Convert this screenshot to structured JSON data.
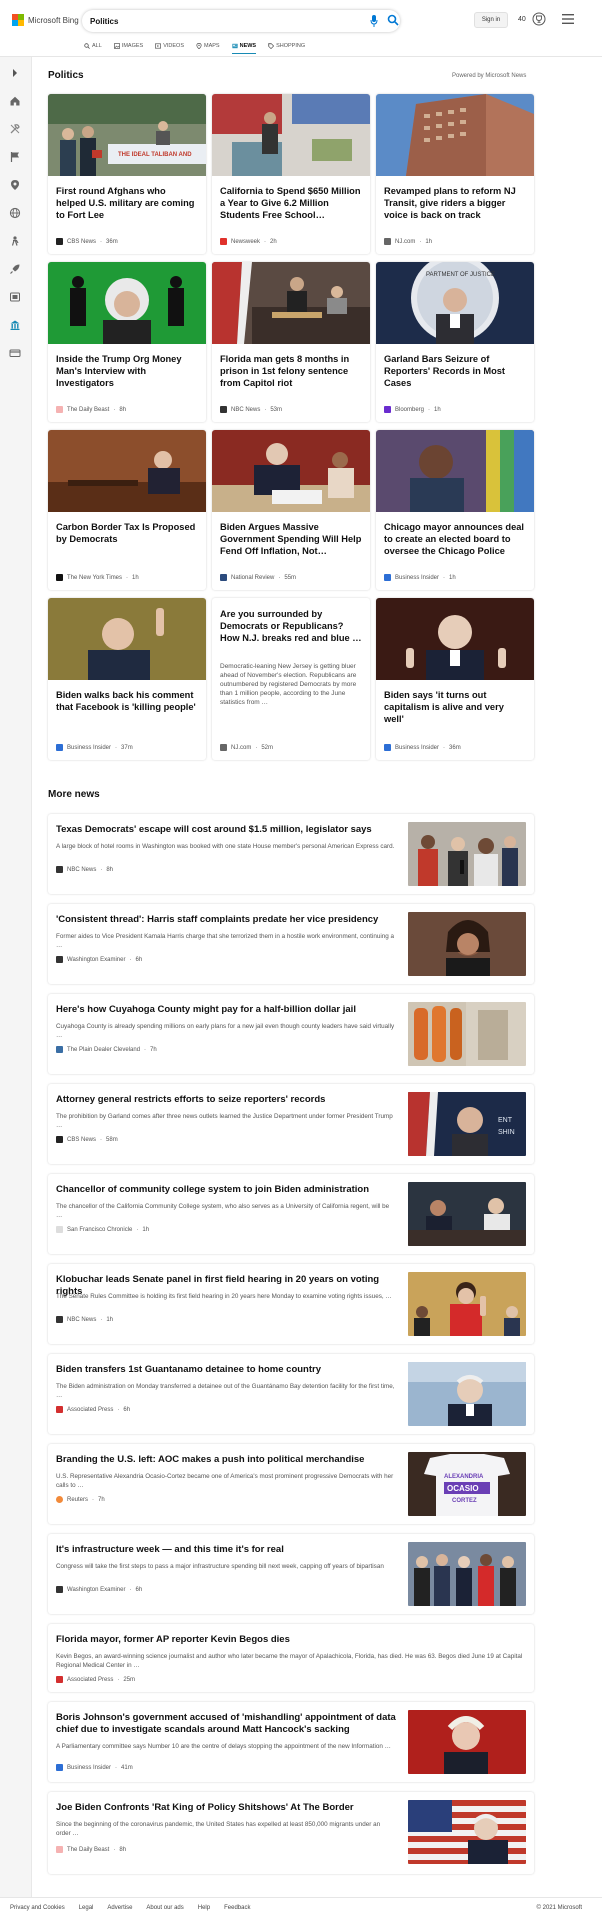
{
  "header": {
    "brand": "Microsoft Bing",
    "search_value": "Politics",
    "signin_label": "Sign in",
    "rewards_count": "40"
  },
  "tabs": [
    {
      "label": "ALL",
      "icon": "search-icon"
    },
    {
      "label": "IMAGES",
      "icon": "image-icon"
    },
    {
      "label": "VIDEOS",
      "icon": "video-icon"
    },
    {
      "label": "MAPS",
      "icon": "map-pin-icon"
    },
    {
      "label": "NEWS",
      "icon": "news-icon",
      "active": true
    },
    {
      "label": "SHOPPING",
      "icon": "tag-icon"
    }
  ],
  "politics": {
    "title": "Politics",
    "powered_by": "Powered by Microsoft News",
    "cards": [
      {
        "title": "First round Afghans who helped U.S. military are coming to Fort Lee",
        "source": "CBS News",
        "time": "36m"
      },
      {
        "title": "California to Spend $650 Million a Year to Give 6.2 Million Students Free School…",
        "source": "Newsweek",
        "time": "2h"
      },
      {
        "title": "Revamped plans to reform NJ Transit, give riders a bigger voice is back on track",
        "source": "NJ.com",
        "time": "1h"
      },
      {
        "title": "Inside the Trump Org Money Man's Interview with Investigators",
        "source": "The Daily Beast",
        "time": "8h"
      },
      {
        "title": "Florida man gets 8 months in prison in 1st felony sentence from Capitol riot",
        "source": "NBC News",
        "time": "53m"
      },
      {
        "title": "Garland Bars Seizure of Reporters' Records in Most Cases",
        "source": "Bloomberg",
        "time": "1h"
      },
      {
        "title": "Carbon Border Tax Is Proposed by Democrats",
        "source": "The New York Times",
        "time": "1h"
      },
      {
        "title": "Biden Argues Massive Government Spending Will Help Fend Off Inflation, Not…",
        "source": "National Review",
        "time": "55m"
      },
      {
        "title": "Chicago mayor announces deal to create an elected board to oversee the Chicago Police",
        "source": "Business Insider",
        "time": "1h"
      },
      {
        "title": "Biden walks back his comment that Facebook is 'killing people'",
        "source": "Business Insider",
        "time": "37m"
      },
      {
        "title": "Are you surrounded by Democrats or Republicans? How N.J. breaks red and blue …",
        "snippet": "Democratic-leaning New Jersey is getting bluer ahead of November's election. Republicans are outnumbered by registered Democrats by more than 1 million people, according to the June statistics from …",
        "source": "NJ.com",
        "time": "52m"
      },
      {
        "title": "Biden says 'it turns out capitalism is alive and very well'",
        "source": "Business Insider",
        "time": "36m"
      }
    ]
  },
  "more_news": {
    "title": "More news",
    "items": [
      {
        "title": "Texas Democrats' escape will cost around $1.5 million, legislator says",
        "snippet": "A large block of hotel rooms in Washington was booked with one state House member's personal American Express card.",
        "source": "NBC News",
        "time": "8h"
      },
      {
        "title": "'Consistent thread': Harris staff complaints predate her vice presidency",
        "snippet": "Former aides to Vice President Kamala Harris charge that she terrorized them in a hostile work environment, continuing a …",
        "source": "Washington Examiner",
        "time": "6h"
      },
      {
        "title": "Here's how Cuyahoga County might pay for a half-billion dollar jail",
        "snippet": "Cuyahoga County is already spending millions on early plans for a new jail even though county leaders have said virtually …",
        "source": "The Plain Dealer Cleveland",
        "time": "7h"
      },
      {
        "title": "Attorney general restricts efforts to seize reporters' records",
        "snippet": "The prohibition by Garland comes after three news outlets learned the Justice Department under former President Trump …",
        "source": "CBS News",
        "time": "58m"
      },
      {
        "title": "Chancellor of community college system to join Biden administration",
        "snippet": "The chancellor of the California Community College system, who also serves as a University of California regent, will be …",
        "source": "San Francisco Chronicle",
        "time": "1h"
      },
      {
        "title": "Klobuchar leads Senate panel in first field hearing in 20 years on voting rights",
        "snippet": "The Senate Rules Committee is holding its first field hearing in 20 years here Monday to examine voting rights issues, …",
        "source": "NBC News",
        "time": "1h"
      },
      {
        "title": "Biden transfers 1st Guantanamo detainee to home country",
        "snippet": "The Biden administration on Monday transferred a detainee out of the Guantánamo Bay detention facility for the first time, …",
        "source": "Associated Press",
        "time": "6h"
      },
      {
        "title": "Branding the U.S. left: AOC makes a push into political merchandise",
        "snippet": "U.S. Representative Alexandria Ocasio-Cortez became one of America's most prominent progressive Democrats with her calls to …",
        "source": "Reuters",
        "time": "7h"
      },
      {
        "title": "It's infrastructure week — and this time it's for real",
        "snippet": "Congress will take the first steps to pass a major infrastructure spending bill next week, capping off years of bipartisan",
        "source": "Washington Examiner",
        "time": "6h"
      },
      {
        "title": "Florida mayor, former AP reporter Kevin Begos dies",
        "snippet": "Kevin Begos, an award-winning science journalist and author who later became the mayor of Apalachicola, Florida, has died. He was 63. Begos died June 19 at Capital Regional Medical Center in …",
        "source": "Associated Press",
        "time": "25m"
      },
      {
        "title": "Boris Johnson's government accused of 'mishandling' appointment of data chief due to investigate scandals around Matt Hancock's sacking",
        "snippet": "A Parliamentary committee says Number 10 are the centre of delays stopping the appointment of the new Information …",
        "source": "Business Insider",
        "time": "41m"
      },
      {
        "title": "Joe Biden Confronts 'Rat King of Policy Shitshows' At The Border",
        "snippet": "Since the beginning of the coronavirus pandemic, the United States has expelled at least 850,000 migrants under an order …",
        "source": "The Daily Beast",
        "time": "8h"
      }
    ]
  },
  "footer": {
    "links": [
      "Privacy and Cookies",
      "Legal",
      "Advertise",
      "About our ads",
      "Help",
      "Feedback"
    ],
    "copyright": "© 2021 Microsoft"
  },
  "colors": {
    "accent": "#178ab4",
    "bing_blue": "#0078d4"
  }
}
